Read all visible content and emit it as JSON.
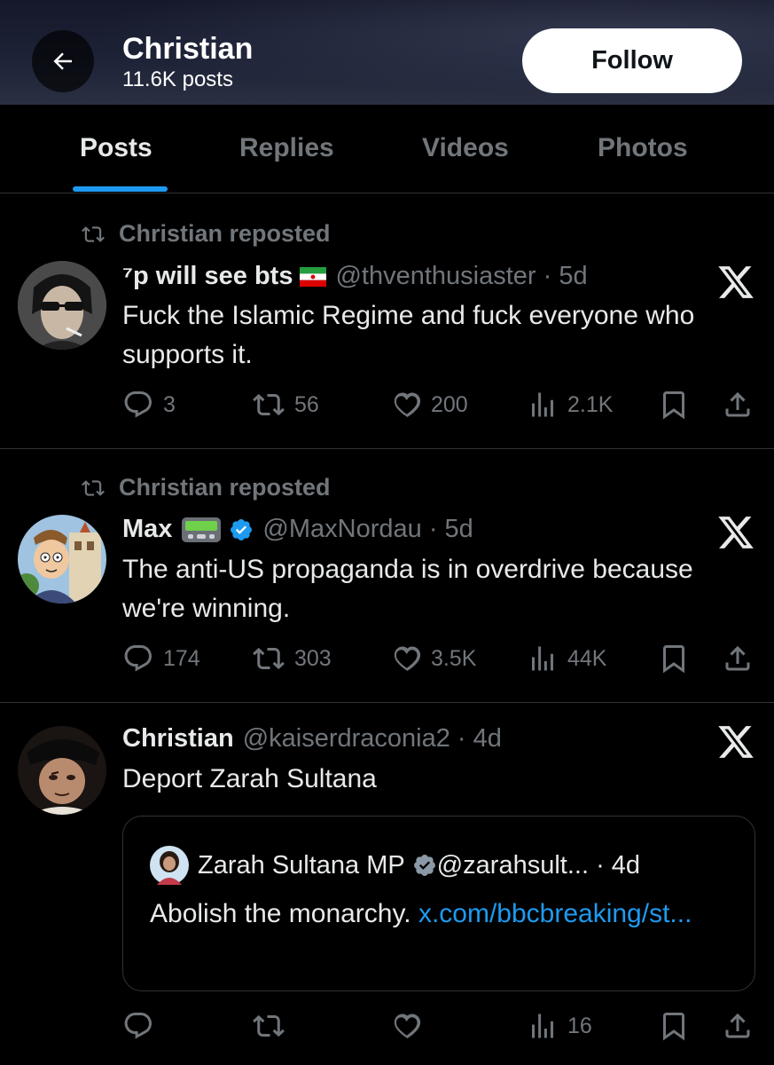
{
  "header": {
    "profile_name": "Christian",
    "post_count": "11.6K posts",
    "follow_label": "Follow"
  },
  "tabs": [
    {
      "label": "Posts",
      "active": true
    },
    {
      "label": "Replies",
      "active": false
    },
    {
      "label": "Videos",
      "active": false
    },
    {
      "label": "Photos",
      "active": false
    }
  ],
  "posts": [
    {
      "repost_label": "Christian reposted",
      "display_name": "⁷p will see bts",
      "flag": "iran-flag-icon",
      "handle": "@thventhusiaster · 5d",
      "text": "Fuck the Islamic Regime and fuck everyone who supports it.",
      "replies": "3",
      "reposts": "56",
      "likes": "200",
      "views": "2.1K"
    },
    {
      "repost_label": "Christian reposted",
      "display_name": "Max",
      "badge": "pager-emoji",
      "verified": true,
      "handle": "@MaxNordau · 5d",
      "text": "The anti-US propaganda is in overdrive because we're winning.",
      "replies": "174",
      "reposts": "303",
      "likes": "3.5K",
      "views": "44K"
    },
    {
      "display_name": "Christian",
      "handle": "@kaiserdraconia2 · 4d",
      "text": "Deport Zarah Sultana",
      "quote": {
        "display_name": "Zarah Sultana MP",
        "verified": true,
        "handle": "@zarahsult... · 4d",
        "text": "Abolish the monarchy.",
        "link_text": "x.com/bbcbreaking/st..."
      },
      "replies": "",
      "reposts": "",
      "likes": "",
      "views": "16"
    }
  ],
  "colors": {
    "accent": "#1d9bf0",
    "muted": "#71767b",
    "text": "#e7e9ea",
    "divider": "#2f3336"
  }
}
